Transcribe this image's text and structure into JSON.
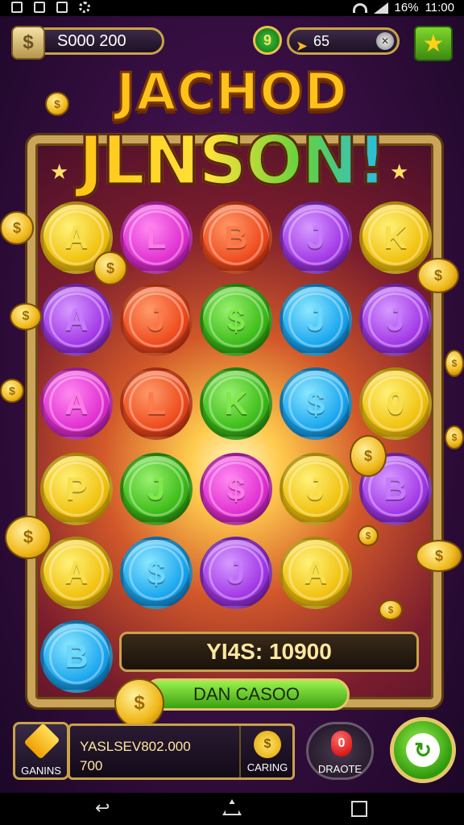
{
  "status_bar": {
    "battery": "16%",
    "time": "11:00"
  },
  "hud": {
    "balance": "S000 200",
    "coin_symbol": "$",
    "level": "9",
    "xp": "65",
    "star_icon": "star-icon"
  },
  "title": {
    "line1": "JACHOD",
    "line2": "JLNSON!"
  },
  "board": {
    "rows": [
      [
        {
          "letter": "A",
          "color": "yellow"
        },
        {
          "letter": "L",
          "color": "pink"
        },
        {
          "letter": "B",
          "color": "orange"
        },
        {
          "letter": "J",
          "color": "purple"
        },
        {
          "letter": "K",
          "color": "yellow"
        }
      ],
      [
        {
          "letter": "A",
          "color": "purple"
        },
        {
          "letter": "J",
          "color": "orange"
        },
        {
          "letter": "$",
          "color": "green"
        },
        {
          "letter": "J",
          "color": "blue"
        },
        {
          "letter": "J",
          "color": "purple"
        }
      ],
      [
        {
          "letter": "A",
          "color": "pink"
        },
        {
          "letter": "L",
          "color": "orange"
        },
        {
          "letter": "K",
          "color": "green"
        },
        {
          "letter": "$",
          "color": "blue"
        },
        {
          "letter": "0",
          "color": "yellow"
        }
      ],
      [
        {
          "letter": "P",
          "color": "yellow"
        },
        {
          "letter": "J",
          "color": "green"
        },
        {
          "letter": "$",
          "color": "pink"
        },
        {
          "letter": "J",
          "color": "yellow"
        },
        {
          "letter": "B",
          "color": "purple"
        }
      ],
      [
        {
          "letter": "A",
          "color": "yellow"
        },
        {
          "letter": "$",
          "color": "blue"
        },
        {
          "letter": "J",
          "color": "purple"
        },
        {
          "letter": "A",
          "color": "yellow"
        }
      ],
      [
        {
          "letter": "B",
          "color": "blue"
        }
      ]
    ],
    "win_text": "YI4S: 10900",
    "spin_label": "DAN CASOO"
  },
  "bottom": {
    "games_label": "GANINS",
    "bet_line1": "YASLSEV802.000",
    "bet_line2": "700",
    "caring_label": "CARING",
    "caring_symbol": "$",
    "draote_label": "DRAOTE",
    "draote_value": "0"
  }
}
